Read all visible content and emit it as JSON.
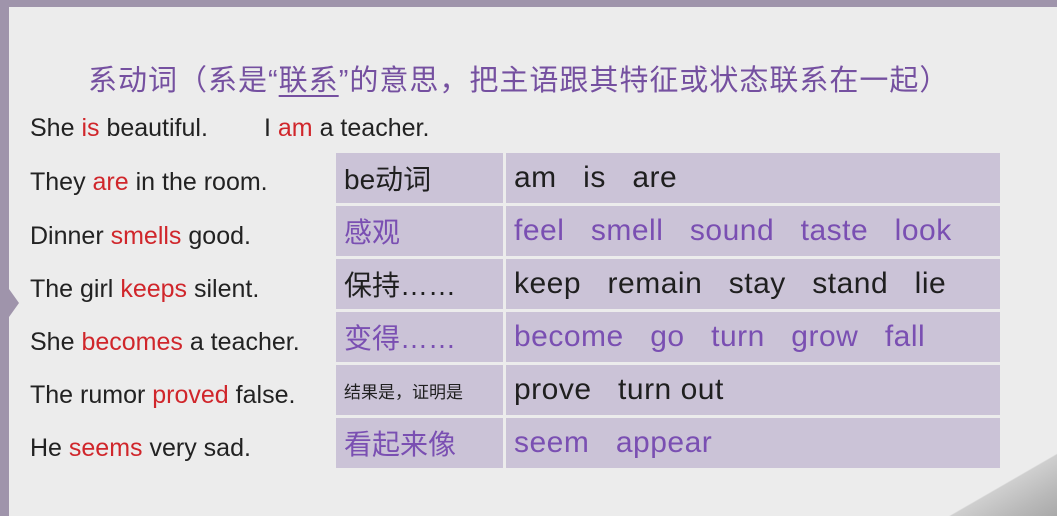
{
  "title": {
    "before": "系动词（系是“",
    "underlined": "联系",
    "after": "”的意思，把主语跟其特征或状态联系在一起）"
  },
  "intro": {
    "s1_pre": "She ",
    "s1_verb": "is",
    "s1_post": " beautiful.",
    "s2_pre": "I ",
    "s2_verb": "am",
    "s2_post": " a teacher."
  },
  "rows": [
    {
      "pre": "They ",
      "verb": "are",
      "post": " in the room.",
      "category": "be动词",
      "words": "am   is   are"
    },
    {
      "pre": "Dinner ",
      "verb": "smells",
      "post": " good.",
      "category": "感观",
      "words": "feel   smell   sound   taste   look"
    },
    {
      "pre": "The girl ",
      "verb": "keeps",
      "post": " silent.",
      "category": "保持……",
      "words": "keep   remain   stay   stand   lie"
    },
    {
      "pre": "She ",
      "verb": "becomes",
      "post": " a teacher.",
      "category": "变得……",
      "words": "become   go   turn   grow   fall"
    },
    {
      "pre": "The rumor ",
      "verb": "proved",
      "post": " false.",
      "category": "结果是，证明是",
      "words": "prove   turn out"
    },
    {
      "pre": "He ",
      "verb": "seems",
      "post": " very sad.",
      "category": "看起来像",
      "words": "seem   appear"
    }
  ],
  "colors": {
    "verb": "#d0262b",
    "title": "#7550a0",
    "table_bg": "#cbc3d7",
    "purple_text": "#7a4fb2",
    "frame": "#9f94ab"
  }
}
